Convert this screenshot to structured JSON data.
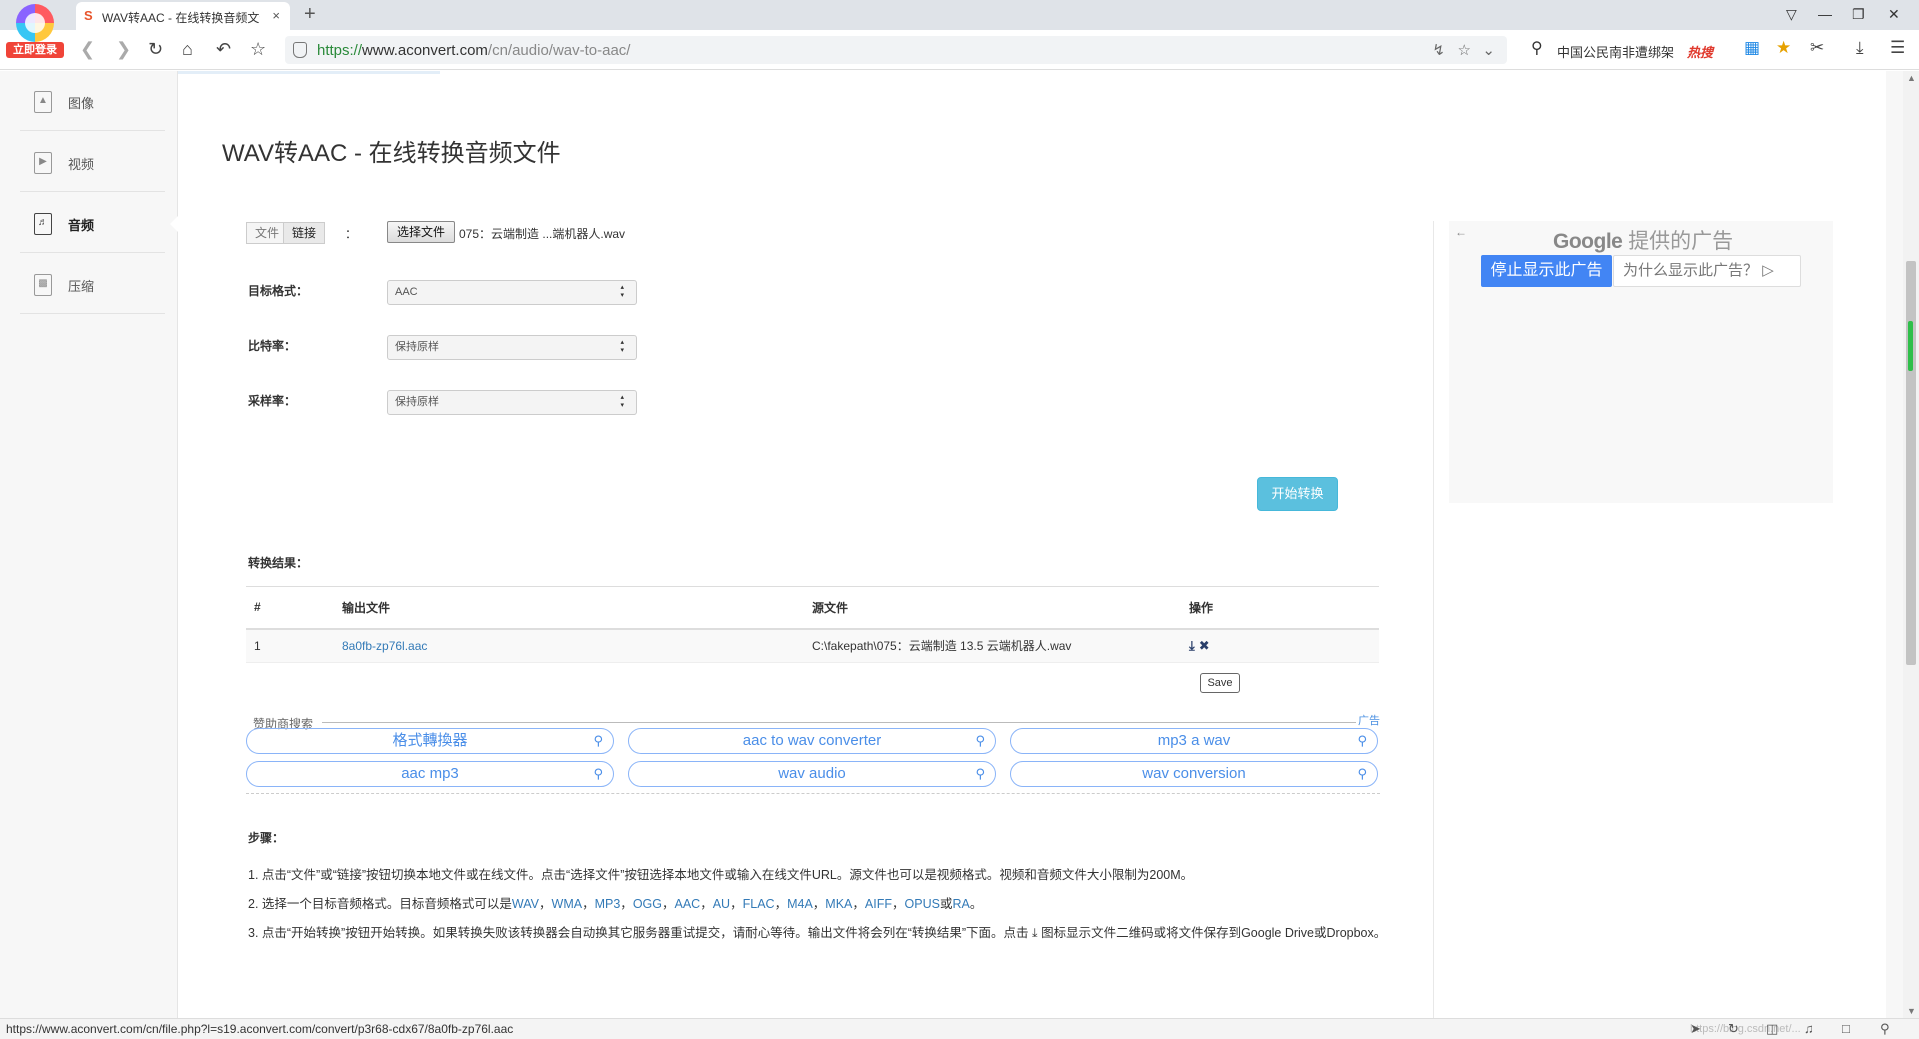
{
  "browser": {
    "login_badge": "立即登录",
    "tab_title": "WAV转AAC - 在线转换音频文件",
    "tab_close": "×",
    "new_tab": "+",
    "url_protocol": "https://",
    "url_host": "www.aconvert.com",
    "url_path": "/cn/audio/wav-to-aac/",
    "search_text": "中国公民南非遭绑架",
    "hot_label": "热搜",
    "win_controls": [
      "▽",
      "—",
      "❐",
      "✕"
    ]
  },
  "sidebar": {
    "items": [
      {
        "label": "图像",
        "icon": "image-icon"
      },
      {
        "label": "视频",
        "icon": "video-icon"
      },
      {
        "label": "音频",
        "icon": "audio-icon"
      },
      {
        "label": "压缩",
        "icon": "archive-icon"
      }
    ],
    "active_index": 2
  },
  "main": {
    "title": "WAV转AAC - 在线转换音频文件",
    "source_toggle": {
      "file": "文件",
      "link": "链接",
      "colon": "："
    },
    "choose_file_label": "选择文件",
    "chosen_file": "075：云端制造 ...端机器人.wav",
    "target_format_label": "目标格式：",
    "target_format_value": "AAC",
    "bitrate_label": "比特率：",
    "bitrate_value": "保持原样",
    "samplerate_label": "采样率：",
    "samplerate_value": "保持原样",
    "start_button": "开始转换",
    "result_label": "转换结果：",
    "table": {
      "headers": [
        "#",
        "输出文件",
        "源文件",
        "操作"
      ],
      "rows": [
        {
          "index": "1",
          "output": "8a0fb-zp76l.aac",
          "source": "C:\\fakepath\\075：云端制造 13.5 云端机器人.wav"
        }
      ]
    },
    "save_button": "Save",
    "sponsor": {
      "title": "赞助商搜索",
      "ad_label": "广告",
      "pills": [
        "格式轉換器",
        "aac to wav converter",
        "mp3 a wav",
        "aac mp3",
        "wav audio",
        "wav conversion"
      ]
    },
    "steps_title": "步骤：",
    "steps": {
      "s1": "1. 点击“文件”或“链接”按钮切换本地文件或在线文件。点击“选择文件”按钮选择本地文件或输入在线文件URL。源文件也可以是视频格式。视频和音频文件大小限制为200M。",
      "s2_prefix": "2. 选择一个目标音频格式。目标音频格式可以是",
      "s2_formats": [
        "WAV",
        "WMA",
        "MP3",
        "OGG",
        "AAC",
        "AU",
        "FLAC",
        "M4A",
        "MKA",
        "AIFF",
        "OPUS"
      ],
      "s2_or": "或",
      "s2_last": "RA",
      "s2_end": "。",
      "s3_a": "3. 点击“开始转换”按钮开始转换。如果转换失败该转换器会自动换其它服务器重试提交，请耐心等待。输出文件将会列在“转换结果”下面。点击",
      "s3_b": "图标显示文件二维码或将文件保存到Google Drive或Dropbox。"
    }
  },
  "ad": {
    "google": "Google",
    "provided": "提供的广告",
    "stop": "停止显示此广告",
    "why": "为什么显示此广告？"
  },
  "status": {
    "url": "https://www.aconvert.com/cn/file.php?l=s19.aconvert.com/convert/p3r68-cdx67/8a0fb-zp76l.aac",
    "watermark": "https://blog.csdn.net/..."
  }
}
